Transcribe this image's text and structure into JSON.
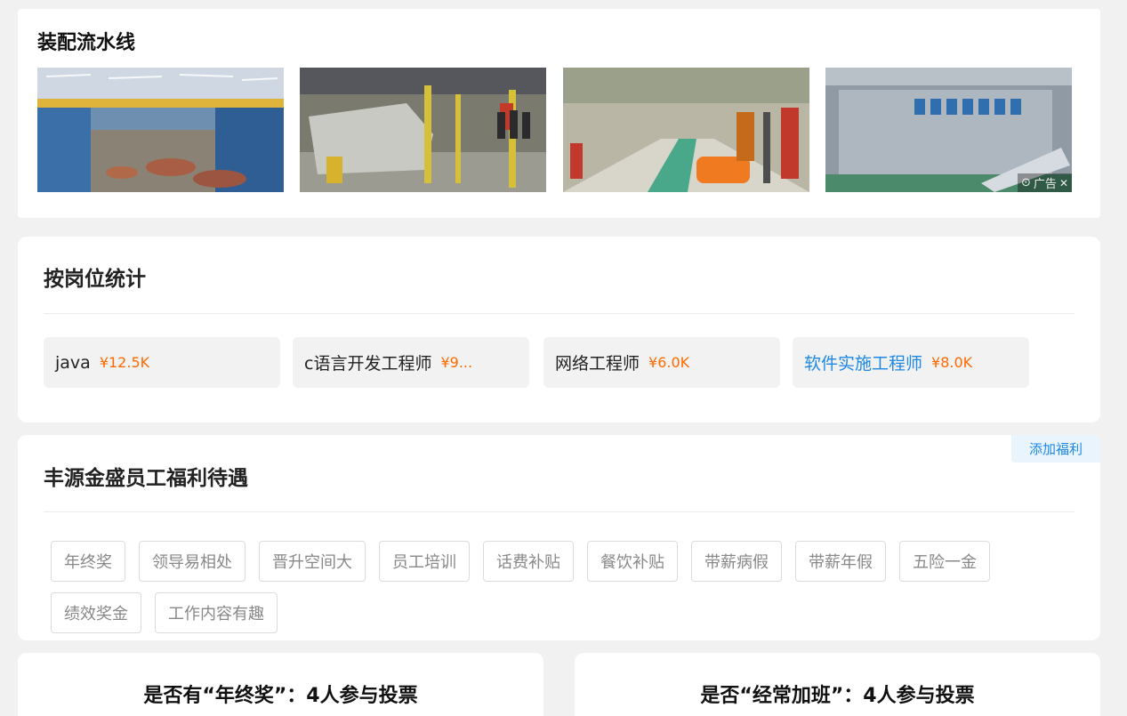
{
  "assembly": {
    "title": "装配流水线",
    "ad_label": "广告"
  },
  "positions": {
    "title": "按岗位统计",
    "items": [
      {
        "name": "java",
        "salary": "¥12.5K"
      },
      {
        "name": "c语言开发工程师",
        "salary": "¥9..."
      },
      {
        "name": "网络工程师",
        "salary": "¥6.0K"
      },
      {
        "name": "软件实施工程师",
        "salary": "¥8.0K"
      }
    ]
  },
  "welfare": {
    "title": "丰源金盛员工福利待遇",
    "add_label": "添加福利",
    "tags": [
      "年终奖",
      "领导易相处",
      "晋升空间大",
      "员工培训",
      "话费补贴",
      "餐饮补贴",
      "带薪病假",
      "带薪年假",
      "五险一金",
      "绩效奖金",
      "工作内容有趣"
    ]
  },
  "votes": {
    "left_title": "是否有“年终奖”：4人参与投票",
    "right_title": "是否“经常加班”：4人参与投票"
  },
  "colors": {
    "accent": "#1e88e5",
    "salary": "#ff6a00",
    "background": "#f1f1f1"
  }
}
